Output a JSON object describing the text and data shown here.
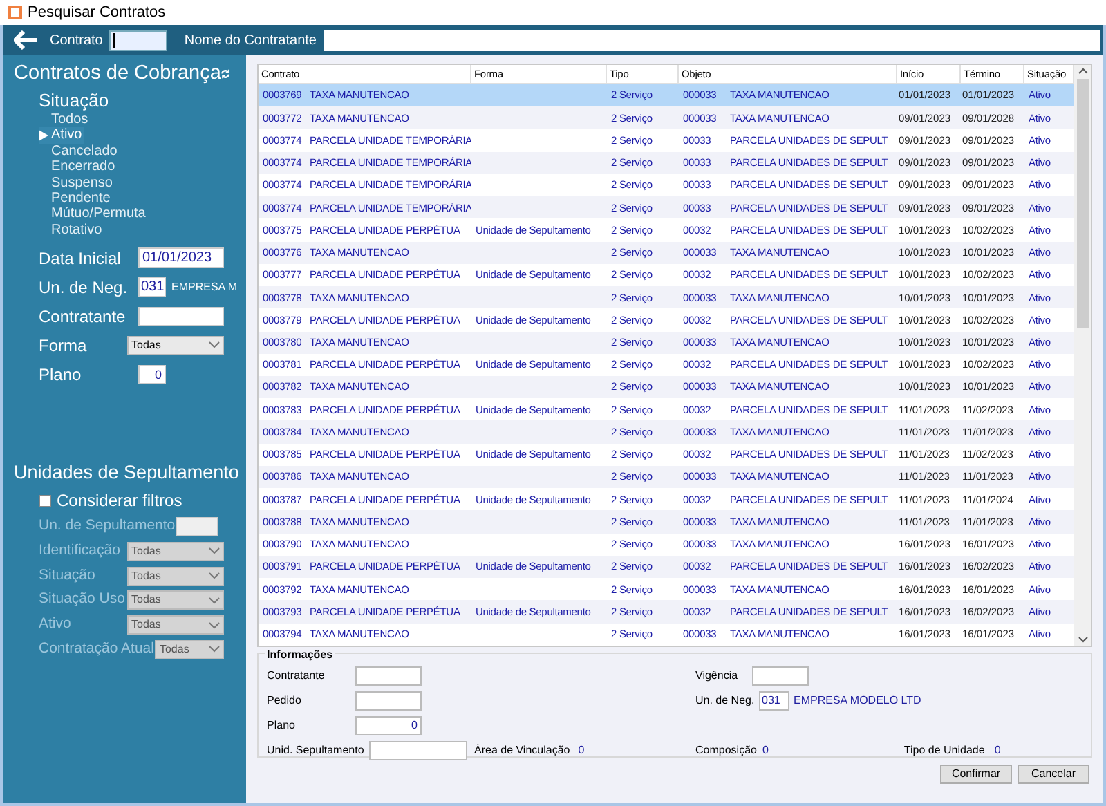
{
  "window": {
    "title": "Pesquisar Contratos"
  },
  "top_bar": {
    "contrato_label": "Contrato",
    "nome_label": "Nome do Contratante"
  },
  "sidebar": {
    "title": "Contratos de Cobrança",
    "situacao_label": "Situação",
    "situacao_items": [
      {
        "label": "Todos",
        "selected": false
      },
      {
        "label": "Ativo",
        "selected": true
      },
      {
        "label": "Cancelado",
        "selected": false
      },
      {
        "label": "Encerrado",
        "selected": false
      },
      {
        "label": "Suspenso",
        "selected": false
      },
      {
        "label": "Pendente",
        "selected": false
      },
      {
        "label": "Mútuo/Permuta",
        "selected": false
      },
      {
        "label": "Rotativo",
        "selected": false
      }
    ],
    "filters": [
      {
        "kind": "date",
        "label": "Data Inicial",
        "value": "01/01/2023"
      },
      {
        "kind": "code",
        "label": "Un. de Neg.",
        "value": "031",
        "name": "EMPRESA M"
      },
      {
        "kind": "text",
        "label": "Contratante"
      },
      {
        "kind": "select",
        "label": "Forma",
        "value": "Todas"
      },
      {
        "kind": "number",
        "label": "Plano",
        "value": "0"
      }
    ],
    "units_title": "Unidades de Sepultamento",
    "consider_label": "Considerar filtros",
    "consider_checked": false,
    "unit_filters": [
      {
        "kind": "text",
        "label": "Un. de Sepultamento",
        "disabled": true
      },
      {
        "kind": "select",
        "label": "Identificação",
        "value": "Todas",
        "disabled": true
      },
      {
        "kind": "select",
        "label": "Situação",
        "value": "Todas",
        "disabled": true
      },
      {
        "kind": "select",
        "label": "Situação Uso",
        "value": "Todas",
        "disabled": true
      },
      {
        "kind": "select",
        "label": "Ativo",
        "value": "Todas",
        "disabled": true
      },
      {
        "kind": "select",
        "label": "Contratação Atual",
        "value": "Todas",
        "disabled": true
      }
    ]
  },
  "table": {
    "columns": [
      "Contrato",
      "Forma",
      "Tipo",
      "Objeto",
      "Início",
      "Término",
      "Situação"
    ],
    "rows": [
      {
        "selected": true,
        "code": "0003769",
        "desc": "TAXA MANUTENCAO",
        "tipo": "2 Serviço",
        "obj": "000033",
        "obj_desc": "TAXA MANUTENCAO",
        "inicio": "01/01/2023",
        "termino": "01/01/2023",
        "situacao": "Ativo"
      },
      {
        "selected": false,
        "code": "0003772",
        "desc": "TAXA MANUTENCAO",
        "tipo": "2 Serviço",
        "obj": "000033",
        "obj_desc": "TAXA MANUTENCAO",
        "inicio": "09/01/2023",
        "termino": "09/01/2028",
        "situacao": "Ativo"
      },
      {
        "selected": false,
        "code": "0003774",
        "desc": "PARCELA UNIDADE TEMPORÁRIA",
        "tipo": "2 Serviço",
        "obj": "00033",
        "obj_desc": "PARCELA UNIDADES DE SEPULT",
        "inicio": "09/01/2023",
        "termino": "09/01/2023",
        "situacao": "Ativo"
      },
      {
        "selected": false,
        "code": "0003774",
        "desc": "PARCELA UNIDADE TEMPORÁRIA",
        "tipo": "2 Serviço",
        "obj": "00033",
        "obj_desc": "PARCELA UNIDADES DE SEPULT",
        "inicio": "09/01/2023",
        "termino": "09/01/2023",
        "situacao": "Ativo"
      },
      {
        "selected": false,
        "code": "0003774",
        "desc": "PARCELA UNIDADE TEMPORÁRIA",
        "tipo": "2 Serviço",
        "obj": "00033",
        "obj_desc": "PARCELA UNIDADES DE SEPULT",
        "inicio": "09/01/2023",
        "termino": "09/01/2023",
        "situacao": "Ativo"
      },
      {
        "selected": false,
        "code": "0003774",
        "desc": "PARCELA UNIDADE TEMPORÁRIA",
        "tipo": "2 Serviço",
        "obj": "00033",
        "obj_desc": "PARCELA UNIDADES DE SEPULT",
        "inicio": "09/01/2023",
        "termino": "09/01/2023",
        "situacao": "Ativo"
      },
      {
        "selected": false,
        "code": "0003775",
        "desc": "PARCELA UNIDADE PERPÉTUA",
        "forma": "Unidade de Sepultamento",
        "tipo": "2 Serviço",
        "obj": "00032",
        "obj_desc": "PARCELA UNIDADES DE SEPULT",
        "inicio": "10/01/2023",
        "termino": "10/02/2023",
        "situacao": "Ativo"
      },
      {
        "selected": false,
        "code": "0003776",
        "desc": "TAXA MANUTENCAO",
        "tipo": "2 Serviço",
        "obj": "000033",
        "obj_desc": "TAXA MANUTENCAO",
        "inicio": "10/01/2023",
        "termino": "10/01/2023",
        "situacao": "Ativo"
      },
      {
        "selected": false,
        "code": "0003777",
        "desc": "PARCELA UNIDADE PERPÉTUA",
        "forma": "Unidade de Sepultamento",
        "tipo": "2 Serviço",
        "obj": "00032",
        "obj_desc": "PARCELA UNIDADES DE SEPULT",
        "inicio": "10/01/2023",
        "termino": "10/02/2023",
        "situacao": "Ativo"
      },
      {
        "selected": false,
        "code": "0003778",
        "desc": "TAXA MANUTENCAO",
        "tipo": "2 Serviço",
        "obj": "000033",
        "obj_desc": "TAXA MANUTENCAO",
        "inicio": "10/01/2023",
        "termino": "10/01/2023",
        "situacao": "Ativo"
      },
      {
        "selected": false,
        "code": "0003779",
        "desc": "PARCELA UNIDADE PERPÉTUA",
        "forma": "Unidade de Sepultamento",
        "tipo": "2 Serviço",
        "obj": "00032",
        "obj_desc": "PARCELA UNIDADES DE SEPULT",
        "inicio": "10/01/2023",
        "termino": "10/02/2023",
        "situacao": "Ativo"
      },
      {
        "selected": false,
        "code": "0003780",
        "desc": "TAXA MANUTENCAO",
        "tipo": "2 Serviço",
        "obj": "000033",
        "obj_desc": "TAXA MANUTENCAO",
        "inicio": "10/01/2023",
        "termino": "10/01/2023",
        "situacao": "Ativo"
      },
      {
        "selected": false,
        "code": "0003781",
        "desc": "PARCELA UNIDADE PERPÉTUA",
        "forma": "Unidade de Sepultamento",
        "tipo": "2 Serviço",
        "obj": "00032",
        "obj_desc": "PARCELA UNIDADES DE SEPULT",
        "inicio": "10/01/2023",
        "termino": "10/02/2023",
        "situacao": "Ativo"
      },
      {
        "selected": false,
        "code": "0003782",
        "desc": "TAXA MANUTENCAO",
        "tipo": "2 Serviço",
        "obj": "000033",
        "obj_desc": "TAXA MANUTENCAO",
        "inicio": "10/01/2023",
        "termino": "10/01/2023",
        "situacao": "Ativo"
      },
      {
        "selected": false,
        "code": "0003783",
        "desc": "PARCELA UNIDADE PERPÉTUA",
        "forma": "Unidade de Sepultamento",
        "tipo": "2 Serviço",
        "obj": "00032",
        "obj_desc": "PARCELA UNIDADES DE SEPULT",
        "inicio": "11/01/2023",
        "termino": "11/02/2023",
        "situacao": "Ativo"
      },
      {
        "selected": false,
        "code": "0003784",
        "desc": "TAXA MANUTENCAO",
        "tipo": "2 Serviço",
        "obj": "000033",
        "obj_desc": "TAXA MANUTENCAO",
        "inicio": "11/01/2023",
        "termino": "11/01/2023",
        "situacao": "Ativo"
      },
      {
        "selected": false,
        "code": "0003785",
        "desc": "PARCELA UNIDADE PERPÉTUA",
        "forma": "Unidade de Sepultamento",
        "tipo": "2 Serviço",
        "obj": "00032",
        "obj_desc": "PARCELA UNIDADES DE SEPULT",
        "inicio": "11/01/2023",
        "termino": "11/02/2023",
        "situacao": "Ativo"
      },
      {
        "selected": false,
        "code": "0003786",
        "desc": "TAXA MANUTENCAO",
        "tipo": "2 Serviço",
        "obj": "000033",
        "obj_desc": "TAXA MANUTENCAO",
        "inicio": "11/01/2023",
        "termino": "11/01/2023",
        "situacao": "Ativo"
      },
      {
        "selected": false,
        "code": "0003787",
        "desc": "PARCELA UNIDADE PERPÉTUA",
        "forma": "Unidade de Sepultamento",
        "tipo": "2 Serviço",
        "obj": "00032",
        "obj_desc": "PARCELA UNIDADES DE SEPULT",
        "inicio": "11/01/2023",
        "termino": "11/01/2024",
        "situacao": "Ativo"
      },
      {
        "selected": false,
        "code": "0003788",
        "desc": "TAXA MANUTENCAO",
        "tipo": "2 Serviço",
        "obj": "000033",
        "obj_desc": "TAXA MANUTENCAO",
        "inicio": "11/01/2023",
        "termino": "11/01/2023",
        "situacao": "Ativo"
      },
      {
        "selected": false,
        "code": "0003790",
        "desc": "TAXA MANUTENCAO",
        "tipo": "2 Serviço",
        "obj": "000033",
        "obj_desc": "TAXA MANUTENCAO",
        "inicio": "16/01/2023",
        "termino": "16/01/2023",
        "situacao": "Ativo"
      },
      {
        "selected": false,
        "code": "0003791",
        "desc": "PARCELA UNIDADE PERPÉTUA",
        "forma": "Unidade de Sepultamento",
        "tipo": "2 Serviço",
        "obj": "00032",
        "obj_desc": "PARCELA UNIDADES DE SEPULT",
        "inicio": "16/01/2023",
        "termino": "16/02/2023",
        "situacao": "Ativo"
      },
      {
        "selected": false,
        "code": "0003792",
        "desc": "TAXA MANUTENCAO",
        "tipo": "2 Serviço",
        "obj": "000033",
        "obj_desc": "TAXA MANUTENCAO",
        "inicio": "16/01/2023",
        "termino": "16/01/2023",
        "situacao": "Ativo"
      },
      {
        "selected": false,
        "code": "0003793",
        "desc": "PARCELA UNIDADE PERPÉTUA",
        "forma": "Unidade de Sepultamento",
        "tipo": "2 Serviço",
        "obj": "00032",
        "obj_desc": "PARCELA UNIDADES DE SEPULT",
        "inicio": "16/01/2023",
        "termino": "16/02/2023",
        "situacao": "Ativo"
      },
      {
        "selected": false,
        "code": "0003794",
        "desc": "TAXA MANUTENCAO",
        "tipo": "2 Serviço",
        "obj": "000033",
        "obj_desc": "TAXA MANUTENCAO",
        "inicio": "16/01/2023",
        "termino": "16/01/2023",
        "situacao": "Ativo"
      }
    ]
  },
  "info": {
    "title": "Informações",
    "contratante_label": "Contratante",
    "pedido_label": "Pedido",
    "plano_label": "Plano",
    "plano_value": "0",
    "unid_label": "Unid. Sepultamento",
    "area_label": "Área de Vinculação",
    "area_value": "0",
    "vigencia_label": "Vigência",
    "un_neg_label": "Un. de Neg.",
    "un_neg_value": "031",
    "empresa": "EMPRESA MODELO LTD",
    "composicao_label": "Composição",
    "composicao_value": "0",
    "tipo_unidade_label": "Tipo de Unidade",
    "tipo_unidade_value": "0"
  },
  "buttons": [
    "Confirmar",
    "Cancelar"
  ]
}
